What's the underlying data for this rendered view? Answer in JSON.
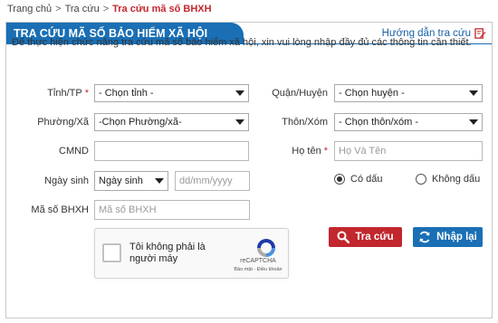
{
  "breadcrumb": {
    "items": [
      "Trang chủ",
      "Tra cứu"
    ],
    "separator": ">",
    "current": "Tra cứu mã số BHXH"
  },
  "panel": {
    "title": "TRA CỨU MÃ SỐ BẢO HIỂM XÃ HỘI",
    "guide_link": "Hướng dẫn tra cứu",
    "guide_icon": "edit-icon",
    "intro": "Để thực hiện chức năng tra cứu mã số bảo hiểm xã hội, xin vui lòng nhập đầy đủ các thông tin cần thiết."
  },
  "form": {
    "province": {
      "label": "Tỉnh/TP",
      "required": "*",
      "value": "- Chọn tỉnh -"
    },
    "district": {
      "label": "Quận/Huyện",
      "value": "- Chọn huyện -"
    },
    "ward": {
      "label": "Phường/Xã",
      "value": "-Chọn Phường/xã-"
    },
    "hamlet": {
      "label": "Thôn/Xóm",
      "value": "- Chọn thôn/xóm -"
    },
    "id_card": {
      "label": "CMND",
      "value": "",
      "placeholder": ""
    },
    "full_name": {
      "label": "Họ tên",
      "required": "*",
      "placeholder": "Họ Và Tên",
      "value": ""
    },
    "birth": {
      "label": "Ngày sinh",
      "type_value": "Ngày sinh",
      "placeholder": "dd/mm/yyyy"
    },
    "accent": {
      "option_on": "Có dấu",
      "option_off": "Không dấu",
      "selected": "Có dấu"
    },
    "bhxh_code": {
      "label": "Mã số BHXH",
      "placeholder": "Mã số BHXH",
      "value": ""
    }
  },
  "captcha": {
    "label": "Tôi không phải là người máy",
    "brand": "reCAPTCHA",
    "links": "Bảo mật - Điều khoản"
  },
  "buttons": {
    "search": "Tra cứu",
    "reset": "Nhập lại"
  },
  "colors": {
    "brand_blue": "#1a6fb5",
    "accent_red": "#c1272d"
  }
}
